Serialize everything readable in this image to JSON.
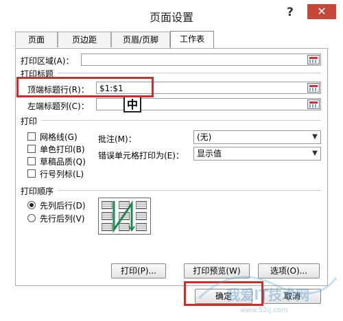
{
  "dialog": {
    "title": "页面设置",
    "help_label": "?",
    "close_label": "✕"
  },
  "tabs": [
    {
      "label": "页面"
    },
    {
      "label": "页边距"
    },
    {
      "label": "页眉/页脚"
    },
    {
      "label": "工作表"
    }
  ],
  "print_area": {
    "label": "打印区域(A)：",
    "value": ""
  },
  "print_titles": {
    "heading": "打印标题",
    "top_rows": {
      "label": "顶端标题行(R)：",
      "value": "$1:$1"
    },
    "left_cols": {
      "label": "左端标题列(C)：",
      "value": ""
    }
  },
  "ime_indicator": "中",
  "print_section": {
    "heading": "打印",
    "checkboxes": [
      {
        "label": "网格线(G)",
        "checked": false
      },
      {
        "label": "单色打印(B)",
        "checked": false
      },
      {
        "label": "草稿品质(Q)",
        "checked": false
      },
      {
        "label": "行号列标(L)",
        "checked": false
      }
    ],
    "comments": {
      "label": "批注(M)：",
      "value": "(无)"
    },
    "errors": {
      "label": "错误单元格打印为(E)：",
      "value": "显示值"
    }
  },
  "page_order": {
    "heading": "打印顺序",
    "options": [
      {
        "label": "先列后行(D)",
        "selected": true
      },
      {
        "label": "先行后列(V)",
        "selected": false
      }
    ]
  },
  "buttons": {
    "print": "打印(P)...",
    "preview": "打印预览(W)",
    "options": "选项(O)...",
    "ok": "确定",
    "cancel": "取消"
  },
  "watermark": {
    "text": "我爱IT技术网",
    "sub": "www.52ij.com"
  },
  "colors": {
    "highlight": "#d42a2a",
    "close_bg": "#c7483a"
  }
}
